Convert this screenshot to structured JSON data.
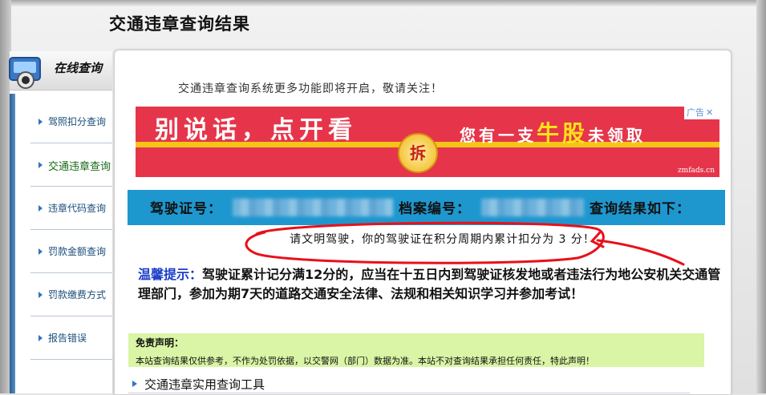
{
  "page": {
    "title": "交通违章查询结果"
  },
  "sidebar": {
    "header_label": "在线查询",
    "items": [
      {
        "label": "驾照扣分查询"
      },
      {
        "label": "交通违章查询"
      },
      {
        "label": "违章代码查询"
      },
      {
        "label": "罚款金额查询"
      },
      {
        "label": "罚款缴费方式"
      },
      {
        "label": "报告错误"
      }
    ]
  },
  "main": {
    "notice": "交通违章查询系统更多功能即将开启，敬请关注！",
    "ad": {
      "left_text": "别说话，点开看",
      "coin_text": "拆",
      "right_pre": "您有一支",
      "right_highlight": "牛股",
      "right_post": "未领取",
      "badge": "广告",
      "badge_close": "✕",
      "domain": "zmfads.cn"
    },
    "result_header": {
      "license_label": "驾驶证号：",
      "file_label": "档案编号：",
      "result_label": "查询结果如下："
    },
    "result_message": "请文明驾驶，你的驾驶证在积分周期内累计扣分为 3 分！",
    "warm_tip": {
      "title": "温馨提示：",
      "body": "驾驶证累计记分满12分的，应当在十五日内到驾驶证核发地或者违法行为地公安机关交通管理部门，参加为期7天的道路交通安全法律、法规和相关知识学习并参加考试！"
    },
    "disclaimer": {
      "title": "免责声明：",
      "body": "本站查询结果仅供参考，不作为处罚依据，以交警网（部门）数据为准。本站不对查询结果承担任何责任，特此声明！"
    },
    "tools_heading": "交通违章实用查询工具"
  },
  "colors": {
    "accent_blue": "#1e97cf",
    "ad_red": "#e6354a",
    "ad_yellow": "#f5c518",
    "disclaimer_green": "#d9f5a5",
    "annotation_red": "#e8101a",
    "tip_title_blue": "#1a3ec8"
  }
}
